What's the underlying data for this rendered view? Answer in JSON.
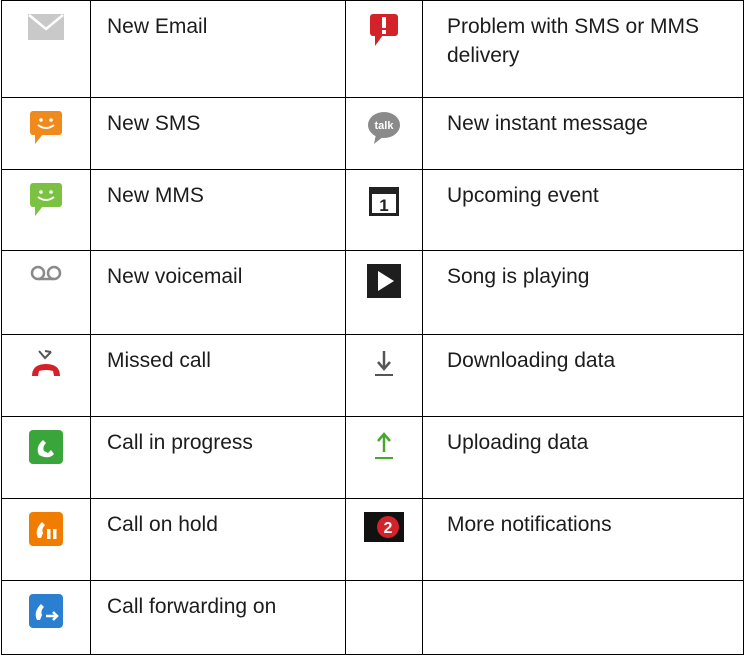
{
  "rows": [
    {
      "left": {
        "icon": "email-icon",
        "label": "New Email"
      },
      "right": {
        "icon": "sms-error-icon",
        "label": "Problem with SMS or MMS delivery"
      }
    },
    {
      "left": {
        "icon": "sms-icon",
        "label": "New SMS"
      },
      "right": {
        "icon": "talk-icon",
        "label": "New instant message"
      }
    },
    {
      "left": {
        "icon": "mms-icon",
        "label": "New MMS"
      },
      "right": {
        "icon": "calendar-icon",
        "label": "Upcoming event"
      }
    },
    {
      "left": {
        "icon": "voicemail-icon",
        "label": "New voicemail"
      },
      "right": {
        "icon": "play-icon",
        "label": "Song is playing"
      }
    },
    {
      "left": {
        "icon": "missed-call-icon",
        "label": "Missed call"
      },
      "right": {
        "icon": "download-icon",
        "label": "Downloading data"
      }
    },
    {
      "left": {
        "icon": "call-in-progress-icon",
        "label": "Call in progress"
      },
      "right": {
        "icon": "upload-icon",
        "label": "Uploading data"
      }
    },
    {
      "left": {
        "icon": "call-on-hold-icon",
        "label": "Call on hold"
      },
      "right": {
        "icon": "more-notifications-icon",
        "label": "More notifications",
        "badge": "2"
      }
    },
    {
      "left": {
        "icon": "call-forwarding-icon",
        "label": "Call forwarding on"
      },
      "right": {
        "icon": "",
        "label": ""
      }
    }
  ],
  "colors": {
    "sms": "#f08a1c",
    "mms": "#7cc242",
    "error": "#d3222a",
    "call_green": "#3aa53a",
    "call_orange": "#f07d00",
    "forward_blue": "#2a7fd0",
    "upload_green": "#4aa62f"
  }
}
